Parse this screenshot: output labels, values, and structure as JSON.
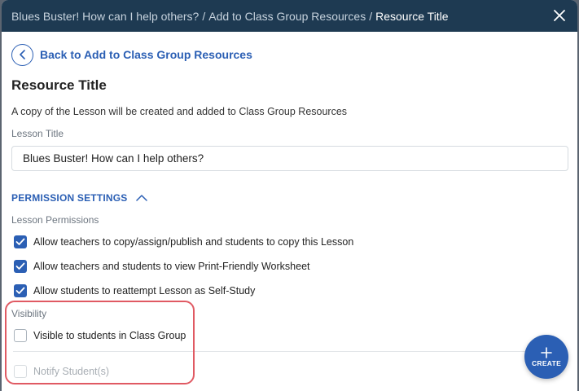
{
  "header": {
    "breadcrumb_1": "Blues Buster! How can I help others?",
    "separator": "/",
    "breadcrumb_2": "Add to Class Group Resources",
    "current": "Resource Title"
  },
  "back_link": {
    "label": "Back to Add to Class Group Resources"
  },
  "page_title": "Resource Title",
  "description": "A copy of the Lesson will be created and added to Class Group Resources",
  "lesson_title": {
    "label": "Lesson Title",
    "value": "Blues Buster! How can I help others?"
  },
  "permission_settings": {
    "header": "PERMISSION SETTINGS",
    "lesson_permissions_label": "Lesson Permissions",
    "options": [
      {
        "label": "Allow teachers to copy/assign/publish and students to copy this Lesson",
        "checked": true
      },
      {
        "label": "Allow teachers and students to view Print-Friendly Worksheet",
        "checked": true
      },
      {
        "label": "Allow students to reattempt Lesson as Self-Study",
        "checked": true
      }
    ]
  },
  "visibility": {
    "label": "Visibility",
    "visible_option": {
      "label": "Visible to students in Class Group",
      "checked": false
    },
    "notify_option": {
      "label": "Notify Student(s)",
      "checked": false,
      "disabled": true
    }
  },
  "create_button": {
    "label": "CREATE"
  },
  "colors": {
    "header_bg": "#1e3a52",
    "accent": "#2b5fb4",
    "highlight": "#e05a63"
  }
}
